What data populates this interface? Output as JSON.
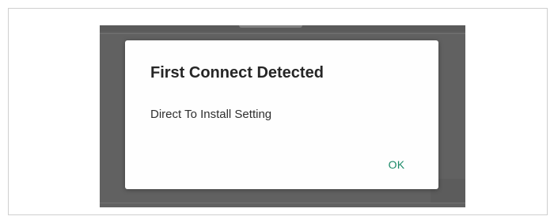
{
  "dialog": {
    "title": "First Connect Detected",
    "message": "Direct To Install Setting",
    "ok_label": "OK"
  },
  "colors": {
    "accent": "#1b8a68",
    "scrim": "#616161",
    "dialog_background": "#fefefe"
  }
}
